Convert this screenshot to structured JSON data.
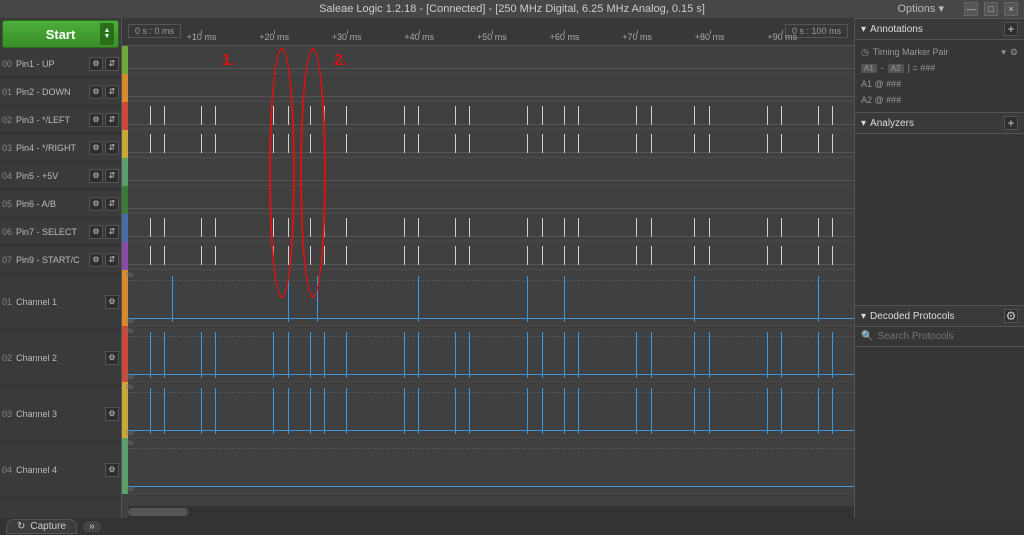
{
  "title": "Saleae Logic 1.2.18 - [Connected] - [250 MHz Digital, 6.25 MHz Analog, 0.15 s]",
  "options_label": "Options ▾",
  "start_label": "Start",
  "timeline": {
    "left_marker": "0 s : 0 ms",
    "right_marker": "0 s : 100 ms",
    "ticks": [
      "+10 ms",
      "+20 ms",
      "+30 ms",
      "+40 ms",
      "+50 ms",
      "+60 ms",
      "+70 ms",
      "+80 ms",
      "+90 ms"
    ]
  },
  "digital_channels": [
    {
      "num": "00",
      "name": "Pin1 - UP",
      "color": "#6ea83a"
    },
    {
      "num": "01",
      "name": "Pin2 - DOWN",
      "color": "#d88b2e"
    },
    {
      "num": "02",
      "name": "Pin3 - */LEFT",
      "color": "#c94a3b"
    },
    {
      "num": "03",
      "name": "Pin4 - */RIGHT",
      "color": "#c8a83a"
    },
    {
      "num": "04",
      "name": "Pin5 - +5V",
      "color": "#5aa06a"
    },
    {
      "num": "05",
      "name": "Pin6 - A/B",
      "color": "#3a7a3a"
    },
    {
      "num": "06",
      "name": "Pin7 - SELECT",
      "color": "#4a6aa8"
    },
    {
      "num": "07",
      "name": "Pin9 - START/C",
      "color": "#8a4aa8"
    }
  ],
  "analog_channels": [
    {
      "num": "01",
      "name": "Channel 1",
      "color": "#d88b2e",
      "top": "8v",
      "bot": "0v"
    },
    {
      "num": "02",
      "name": "Channel 2",
      "color": "#c94a3b",
      "top": "8v",
      "bot": "0v"
    },
    {
      "num": "03",
      "name": "Channel 3",
      "color": "#c8a83a",
      "top": "8v",
      "bot": "0v"
    },
    {
      "num": "04",
      "name": "Channel 4",
      "color": "#5aa06a",
      "top": "8v",
      "bot": "0v"
    }
  ],
  "annotations_marks": {
    "mark1": "1.",
    "mark2": "2."
  },
  "right": {
    "annotations_title": "Annotations",
    "timing_pair_label": "Timing Marker Pair",
    "pair_line": "| A1 - A2 | = ###",
    "a1_line": "A1  @  ###",
    "a2_line": "A2  @  ###",
    "analyzers_title": "Analyzers",
    "decoded_title": "Decoded Protocols",
    "search_placeholder": "Search Protocols"
  },
  "bottom": {
    "capture_label": "Capture"
  },
  "chart_data": {
    "type": "logic-analyzer",
    "time_unit": "ms",
    "x_range": [
      0,
      100
    ],
    "digital_pulse_positions_ms": {
      "Pin3 - */LEFT": [
        3,
        5,
        10,
        12,
        20,
        22,
        25,
        27,
        30,
        38,
        40,
        45,
        47,
        55,
        57,
        60,
        62,
        70,
        72,
        78,
        80,
        88,
        90,
        95,
        97
      ],
      "Pin4 - */RIGHT": [
        3,
        5,
        10,
        12,
        20,
        22,
        25,
        27,
        30,
        38,
        40,
        45,
        47,
        55,
        57,
        60,
        62,
        70,
        72,
        78,
        80,
        88,
        90,
        95,
        97
      ],
      "Pin7 - SELECT": [
        3,
        5,
        10,
        12,
        20,
        22,
        25,
        27,
        30,
        38,
        40,
        45,
        47,
        55,
        57,
        60,
        62,
        70,
        72,
        78,
        80,
        88,
        90,
        95,
        97
      ],
      "Pin9 - START/C": [
        3,
        5,
        10,
        12,
        20,
        22,
        25,
        27,
        30,
        38,
        40,
        45,
        47,
        55,
        57,
        60,
        62,
        70,
        72,
        78,
        80,
        88,
        90,
        95,
        97
      ]
    },
    "analog_pulse_positions_ms": {
      "Channel 1": [
        6,
        22,
        26,
        40,
        55,
        60,
        78,
        95
      ],
      "Channel 2": [
        3,
        5,
        10,
        12,
        20,
        22,
        25,
        27,
        30,
        38,
        40,
        45,
        47,
        55,
        57,
        60,
        62,
        70,
        72,
        78,
        80,
        88,
        90,
        95,
        97
      ],
      "Channel 3": [
        3,
        5,
        10,
        12,
        20,
        22,
        25,
        27,
        30,
        38,
        40,
        45,
        47,
        55,
        57,
        60,
        62,
        70,
        72,
        78,
        80,
        88,
        90,
        95,
        97
      ],
      "Channel 4": []
    },
    "highlight_ellipses": [
      {
        "label": "1.",
        "center_ms": 20,
        "width_ms": 4
      },
      {
        "label": "2.",
        "center_ms": 26,
        "width_ms": 4
      }
    ]
  }
}
